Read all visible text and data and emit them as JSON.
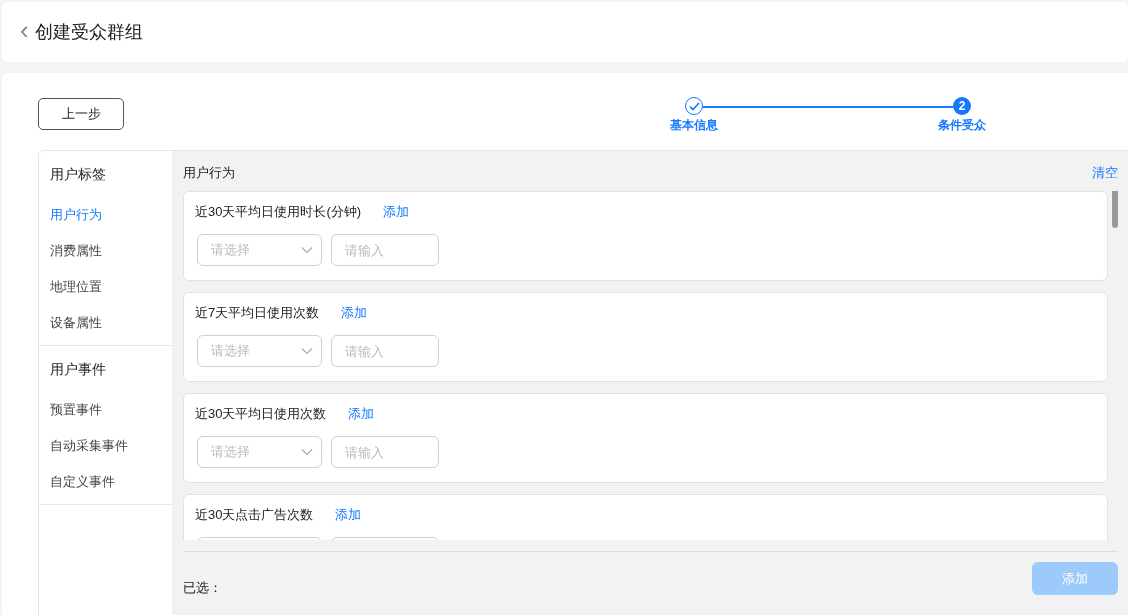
{
  "header": {
    "back_icon": "‹",
    "title": "创建受众群组"
  },
  "prev_button": "上一步",
  "steps": [
    {
      "label": "基本信息",
      "kind": "done"
    },
    {
      "label": "条件受众",
      "kind": "active",
      "number": "2"
    }
  ],
  "sidebar": {
    "groups": [
      {
        "title": "用户标签",
        "items": [
          {
            "label": "用户行为",
            "selected": true
          },
          {
            "label": "消费属性",
            "selected": false
          },
          {
            "label": "地理位置",
            "selected": false
          },
          {
            "label": "设备属性",
            "selected": false
          }
        ]
      },
      {
        "title": "用户事件",
        "items": [
          {
            "label": "预置事件",
            "selected": false
          },
          {
            "label": "自动采集事件",
            "selected": false
          },
          {
            "label": "自定义事件",
            "selected": false
          }
        ]
      }
    ]
  },
  "content": {
    "title": "用户行为",
    "clear_link": "清空",
    "conditions": [
      {
        "name": "近30天平均日使用时长(分钟)",
        "add_link": "添加",
        "select_placeholder": "请选择",
        "input_placeholder": "请输入"
      },
      {
        "name": "近7天平均日使用次数",
        "add_link": "添加",
        "select_placeholder": "请选择",
        "input_placeholder": "请输入"
      },
      {
        "name": "近30天平均日使用次数",
        "add_link": "添加",
        "select_placeholder": "请选择",
        "input_placeholder": "请输入"
      },
      {
        "name": "近30天点击广告次数",
        "add_link": "添加"
      }
    ],
    "selected_label": "已选：",
    "add_button": {
      "label": "添加",
      "disabled": true
    }
  }
}
